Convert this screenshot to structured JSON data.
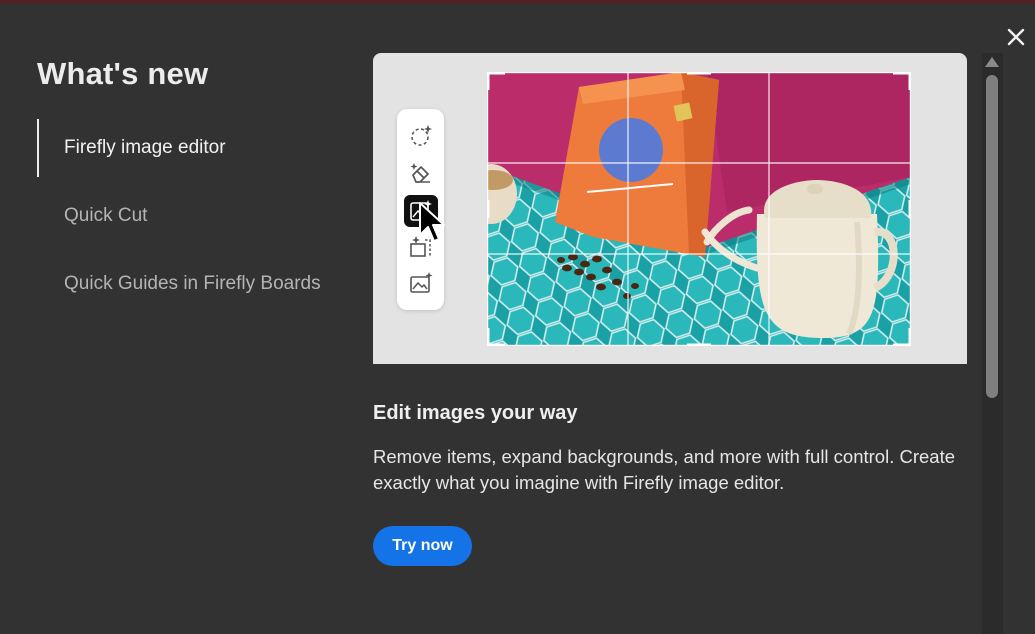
{
  "dialog": {
    "title": "What's new",
    "close_icon": "close-icon"
  },
  "nav": {
    "items": [
      {
        "label": "Firefly image editor",
        "active": true
      },
      {
        "label": "Quick Cut",
        "active": false
      },
      {
        "label": "Quick Guides in Firefly Boards",
        "active": false
      }
    ]
  },
  "hero": {
    "toolbar_icons": [
      "generative-select-icon",
      "generative-remove-icon",
      "generative-fill-icon",
      "generative-expand-icon",
      "image-generate-icon"
    ],
    "active_tool": "generative-fill-icon"
  },
  "content": {
    "headline": "Edit images your way",
    "description": "Remove items, expand backgrounds, and more with full control. Create exactly what you imagine with Firefly image editor.",
    "cta_label": "Try now"
  },
  "colors": {
    "background": "#323232",
    "accent": "#1473e6",
    "text": "#e8e8e8",
    "top_bar": "#5a1d21"
  }
}
